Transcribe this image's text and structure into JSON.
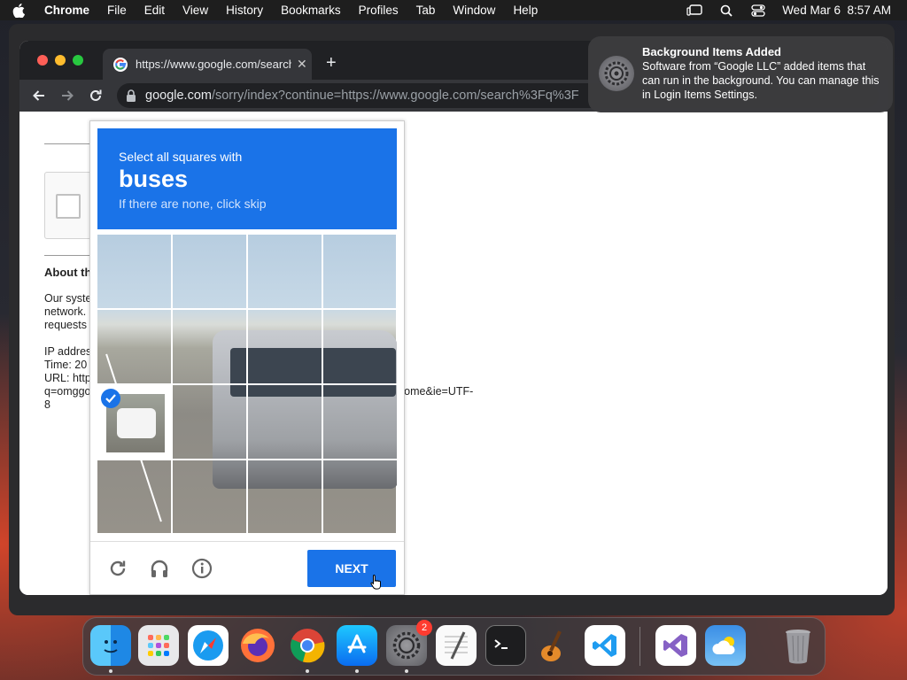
{
  "menubar": {
    "app": "Chrome",
    "items": [
      "File",
      "Edit",
      "View",
      "History",
      "Bookmarks",
      "Profiles",
      "Tab",
      "Window",
      "Help"
    ],
    "clock": "Wed Mar 6  8:57 AM"
  },
  "browser": {
    "tab_title": "https://www.google.com/search",
    "omnibox_domain": "google.com",
    "omnibox_path": "/sorry/index?continue=https://www.google.com/search%3Fq%3F"
  },
  "page": {
    "about_title": "About th",
    "para_lines": [
      "Our syste",
      "network.",
      "requests"
    ],
    "info_lines": [
      "IP addres",
      "Time: 20",
      "URL: http",
      "q=omggo",
      "8"
    ],
    "url_tail": "rome&ie=UTF-"
  },
  "captcha": {
    "line1": "Select all squares with",
    "keyword": "buses",
    "line3": "If there are none, click skip",
    "next_label": "NEXT",
    "selected_tiles": [
      8
    ],
    "colors": {
      "accent": "#1a73e8"
    }
  },
  "notification": {
    "title": "Background Items Added",
    "body": "Software from “Google LLC” added items that can run in the background. You can manage this in Login Items Settings."
  },
  "dock": {
    "items": [
      {
        "name": "finder",
        "running": true
      },
      {
        "name": "launchpad",
        "running": false
      },
      {
        "name": "safari",
        "running": false
      },
      {
        "name": "firefox",
        "running": false
      },
      {
        "name": "chrome",
        "running": true
      },
      {
        "name": "app-store",
        "running": true
      },
      {
        "name": "system-settings",
        "running": true,
        "badge": "2"
      },
      {
        "name": "textedit",
        "running": false
      },
      {
        "name": "terminal",
        "running": false
      },
      {
        "name": "garageband",
        "running": false
      },
      {
        "name": "vscode",
        "running": false
      },
      {
        "name": "visual-studio",
        "running": false
      },
      {
        "name": "weather",
        "running": false
      },
      {
        "name": "trash",
        "running": false
      }
    ],
    "system_settings_badge": "2"
  }
}
